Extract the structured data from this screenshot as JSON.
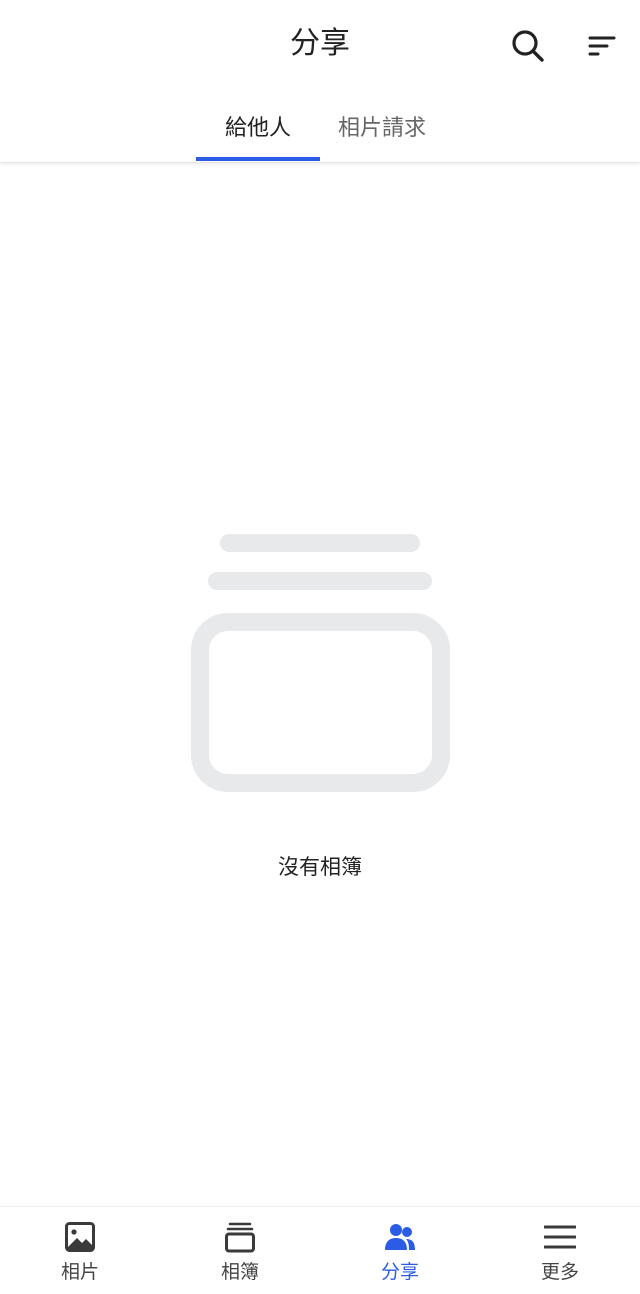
{
  "header": {
    "title": "分享",
    "search_icon": "search-icon",
    "sort_icon": "sort-icon"
  },
  "tabs": [
    {
      "label": "給他人",
      "active": true
    },
    {
      "label": "相片請求",
      "active": false
    }
  ],
  "empty_state": {
    "icon": "album-stack-icon",
    "message": "沒有相簿"
  },
  "bottom_nav": [
    {
      "label": "相片",
      "icon": "image-icon",
      "active": false
    },
    {
      "label": "相簿",
      "icon": "album-icon",
      "active": false
    },
    {
      "label": "分享",
      "icon": "people-icon",
      "active": true
    },
    {
      "label": "更多",
      "icon": "menu-icon",
      "active": false
    }
  ],
  "colors": {
    "accent": "#2b5ce6",
    "text_primary": "#222222",
    "text_secondary": "#666666",
    "illustration": "#e8e9eb"
  }
}
